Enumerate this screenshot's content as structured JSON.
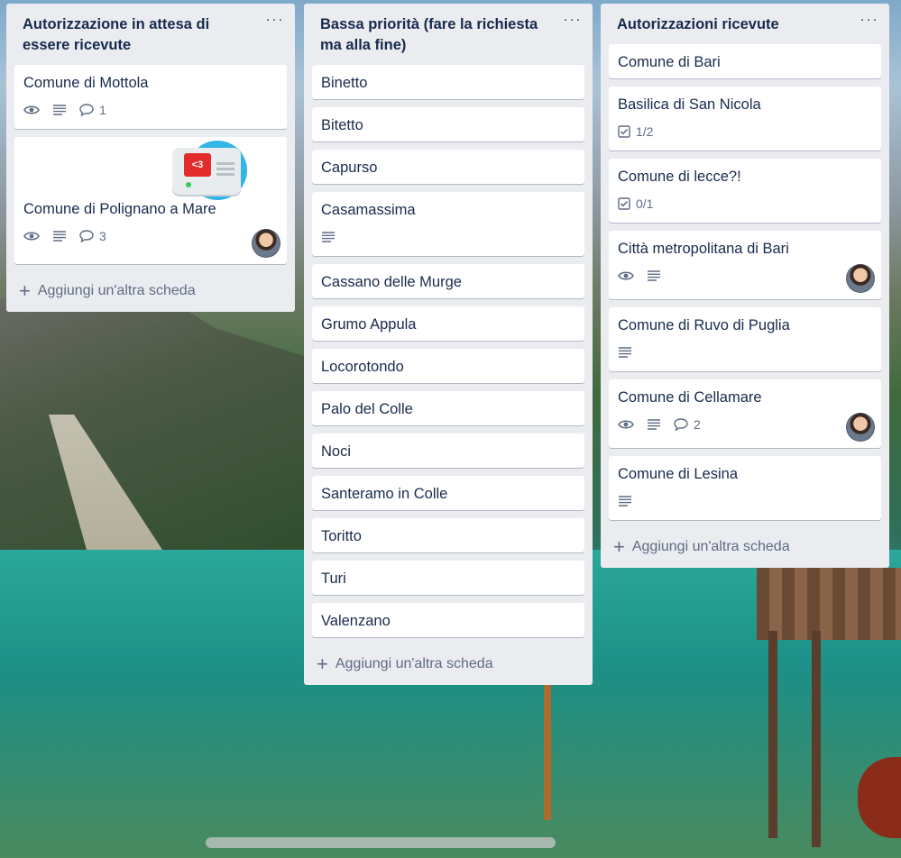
{
  "lists": [
    {
      "title": "Autorizzazione in attesa di essere ricevute",
      "menu": "···",
      "add_label": "Aggiungi un'altra scheda",
      "cards": [
        {
          "title": "Comune di Mottola",
          "watch": true,
          "desc": true,
          "comments": "1"
        },
        {
          "title": "Comune di Polignano a Mare",
          "watch": true,
          "desc": true,
          "comments": "3",
          "cover_text": "<3"
        }
      ]
    },
    {
      "title": "Bassa priorità (fare la richiesta ma alla fine)",
      "menu": "···",
      "add_label": "Aggiungi un'altra scheda",
      "cards": [
        {
          "title": "Binetto"
        },
        {
          "title": "Bitetto"
        },
        {
          "title": "Capurso"
        },
        {
          "title": "Casamassima",
          "desc": true
        },
        {
          "title": "Cassano delle Murge"
        },
        {
          "title": "Grumo Appula"
        },
        {
          "title": "Locorotondo"
        },
        {
          "title": "Palo del Colle"
        },
        {
          "title": "Noci"
        },
        {
          "title": "Santeramo in Colle"
        },
        {
          "title": "Toritto"
        },
        {
          "title": "Turi"
        },
        {
          "title": "Valenzano"
        }
      ]
    },
    {
      "title": "Autorizzazioni ricevute",
      "menu": "···",
      "add_label": "Aggiungi un'altra scheda",
      "cards": [
        {
          "title": "Comune di Bari"
        },
        {
          "title": "Basilica di San Nicola",
          "checklist": "1/2"
        },
        {
          "title": "Comune di lecce?!",
          "checklist": "0/1"
        },
        {
          "title": "Città metropolitana di Bari",
          "watch": true,
          "desc": true
        },
        {
          "title": "Comune di Ruvo di Puglia",
          "desc": true
        },
        {
          "title": "Comune di Cellamare",
          "watch": true,
          "desc": true,
          "comments": "2"
        },
        {
          "title": "Comune di Lesina",
          "desc": true
        }
      ]
    }
  ]
}
